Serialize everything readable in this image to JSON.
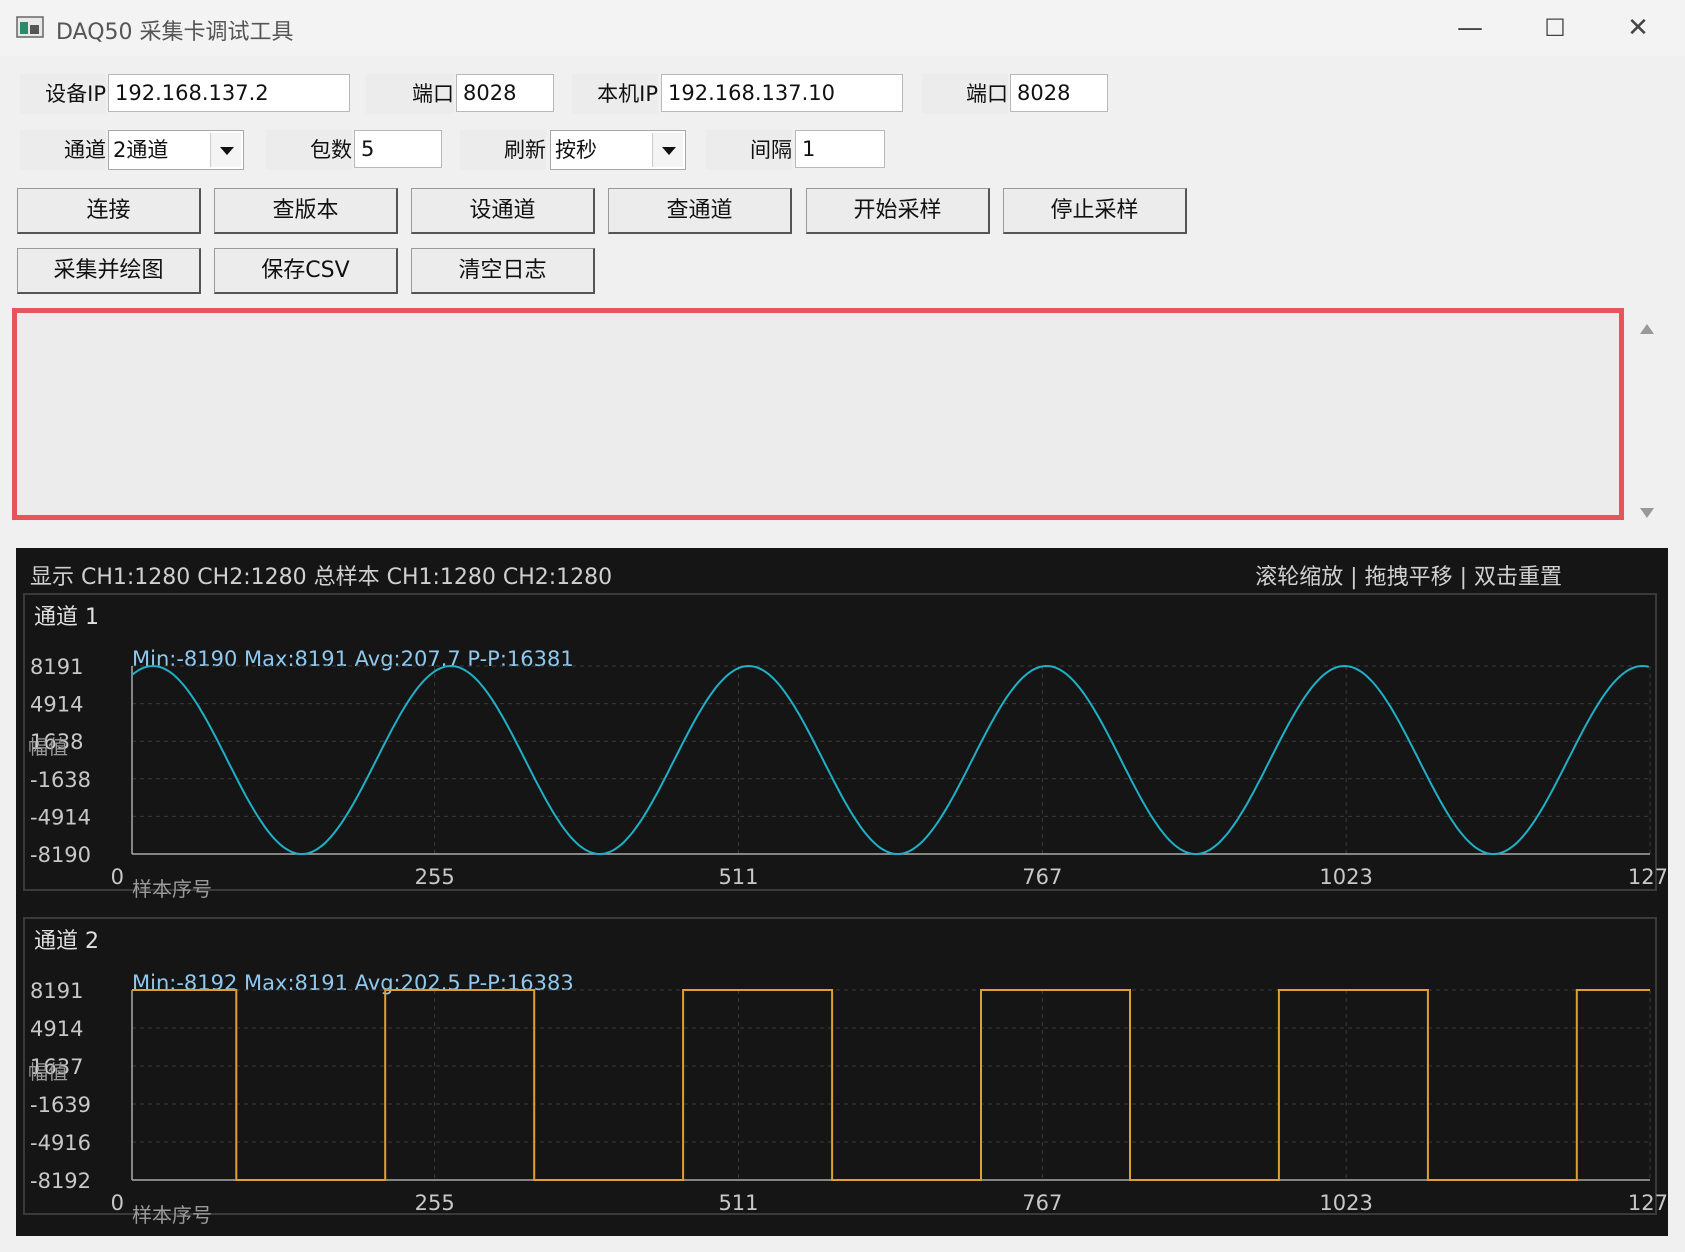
{
  "window": {
    "title": "DAQ50 采集卡调试工具",
    "minimize": "—",
    "maximize": "☐",
    "close": "✕"
  },
  "conn": {
    "device_ip_label": "设备IP",
    "device_ip": "192.168.137.2",
    "port1_label": "端口",
    "port1": "8028",
    "local_ip_label": "本机IP",
    "local_ip": "192.168.137.10",
    "port2_label": "端口",
    "port2": "8028"
  },
  "params": {
    "channel_label": "通道",
    "channel_value": "2通道",
    "packets_label": "包数",
    "packets": "5",
    "refresh_label": "刷新",
    "refresh_value": "按秒",
    "interval_label": "间隔",
    "interval": "1"
  },
  "buttons": {
    "connect": "连接",
    "check_version": "查版本",
    "set_channel": "设通道",
    "check_channel": "查通道",
    "start_sampling": "开始采样",
    "stop_sampling": "停止采样",
    "acquire_plot": "采集并绘图",
    "save_csv": "保存CSV",
    "clear_log": "清空日志"
  },
  "plot": {
    "status": "显示 CH1:1280  CH2:1280  总样本 CH1:1280  CH2:1280",
    "hint": "滚轮缩放 | 拖拽平移 | 双击重置"
  },
  "chart_data": [
    {
      "type": "line",
      "title": "通道 1",
      "stats": "Min:-8190  Max:8191  Avg:207.7  P-P:16381",
      "ylabel": "幅值",
      "xlabel": "样本序号",
      "yticks": [
        "8191",
        "4914",
        "1638",
        "-1638",
        "-4914",
        "-8190"
      ],
      "xticks": [
        "0",
        "255",
        "511",
        "767",
        "1023",
        "127"
      ],
      "ylim": [
        -8190,
        8191
      ],
      "xlim": [
        0,
        1279
      ],
      "color": "#1fb0c8",
      "series": [
        {
          "waveform": "sine",
          "period": 251,
          "amplitude": 8191,
          "start_phase": "rising",
          "n": 1280
        }
      ],
      "grid": true
    },
    {
      "type": "line",
      "title": "通道 2",
      "stats": "Min:-8192  Max:8191  Avg:202.5  P-P:16383",
      "ylabel": "幅值",
      "xlabel": "样本序号",
      "yticks": [
        "8191",
        "4914",
        "1637",
        "-1639",
        "-4916",
        "-8192"
      ],
      "xticks": [
        "0",
        "255",
        "511",
        "767",
        "1023",
        "127"
      ],
      "ylim": [
        -8192,
        8191
      ],
      "xlim": [
        0,
        1279
      ],
      "color": "#e0a030",
      "series": [
        {
          "waveform": "square",
          "period": 251,
          "high": 8191,
          "low": -8192,
          "start_level": "high",
          "n": 1280
        }
      ],
      "grid": true
    }
  ]
}
